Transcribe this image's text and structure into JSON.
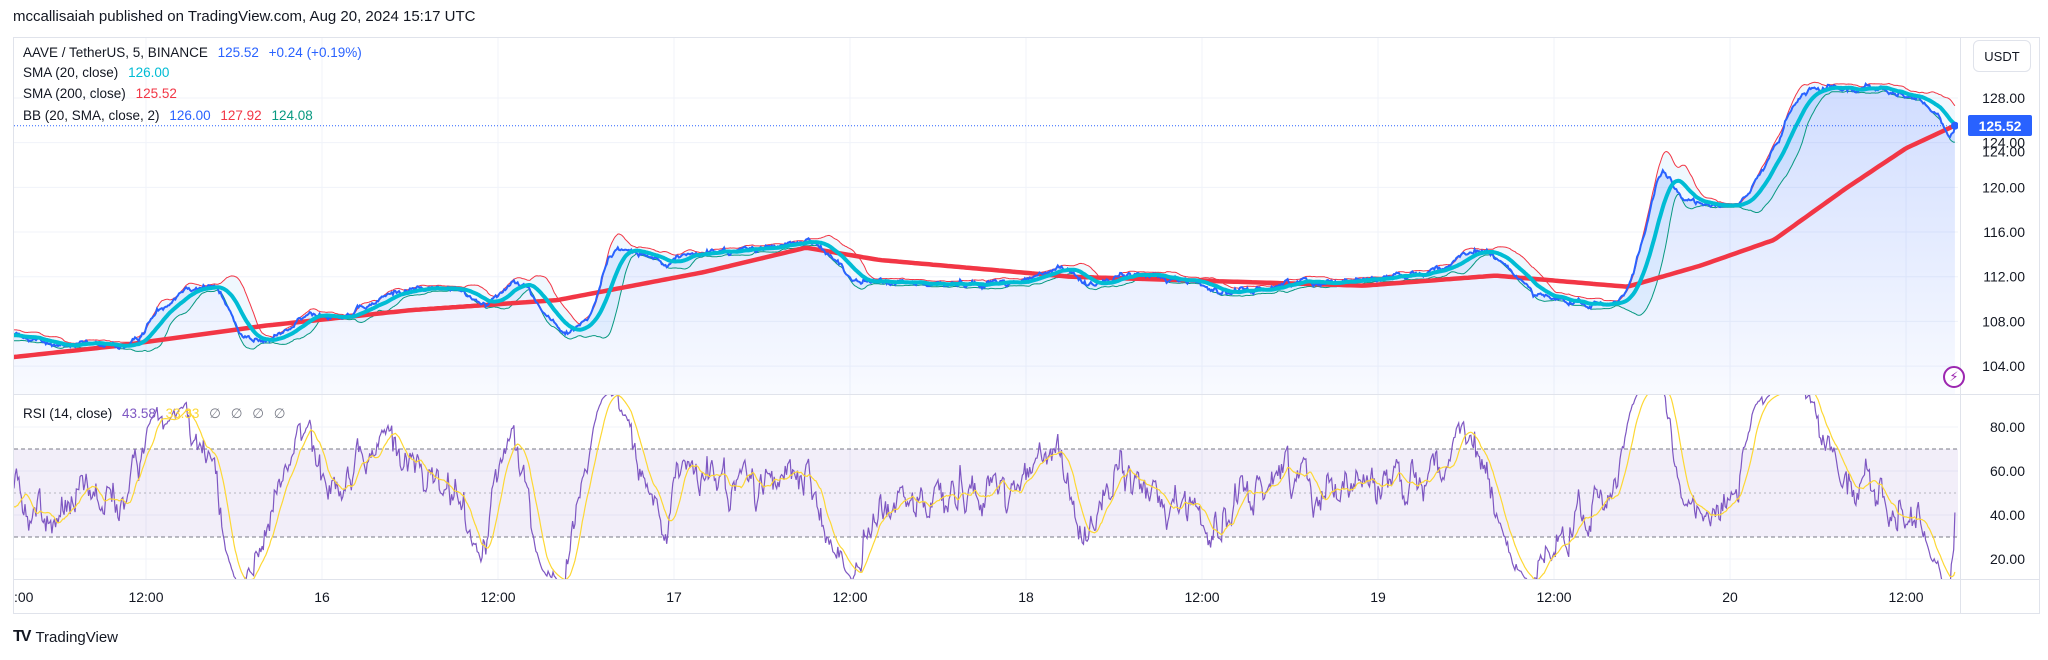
{
  "header": {
    "published": "mccallisaiah published on TradingView.com, Aug 20, 2024 15:17 UTC"
  },
  "legend": {
    "symbol": "AAVE / TetherUS, 5, BINANCE",
    "price": "125.52",
    "change": "+0.24 (+0.19%)",
    "sma20_label": "SMA (20, close)",
    "sma20_value": "126.00",
    "sma200_label": "SMA (200, close)",
    "sma200_value": "125.52",
    "bb_label": "BB (20, SMA, close, 2)",
    "bb_basis": "126.00",
    "bb_upper": "127.92",
    "bb_lower": "124.08",
    "rsi_label": "RSI (14, close)",
    "rsi_value": "43.58",
    "rsi_ma_value": "33.33",
    "rsi_empty": [
      "∅",
      "∅",
      "∅",
      "∅"
    ]
  },
  "price_axis": {
    "currency": "USDT",
    "last_price": "125.52"
  },
  "footer": {
    "brand": "TradingView"
  },
  "colors": {
    "price": "#2962ff",
    "sma20": "#00bcd4",
    "sma200": "#f23645",
    "bb_upper": "#f23645",
    "bb_lower": "#089981",
    "rsi": "#7e57c2",
    "rsi_ma": "#fdd835"
  },
  "chart_data": {
    "type": "line",
    "title": "AAVE / TetherUS, 5, BINANCE",
    "x_unit_hours_from": "Aug 15 00:00",
    "x_ticks": [
      {
        "label": ":00",
        "h": 3
      },
      {
        "label": "12:00",
        "h": 12
      },
      {
        "label": "16",
        "h": 24
      },
      {
        "label": "12:00",
        "h": 36
      },
      {
        "label": "17",
        "h": 48
      },
      {
        "label": "12:00",
        "h": 60
      },
      {
        "label": "18",
        "h": 72
      },
      {
        "label": "12:00",
        "h": 84
      },
      {
        "label": "19",
        "h": 96
      },
      {
        "label": "12:00",
        "h": 108
      },
      {
        "label": "20",
        "h": 120
      },
      {
        "label": "12:00",
        "h": 132
      }
    ],
    "price_ticks": [
      "104.00",
      "108.00",
      "112.00",
      "116.00",
      "120.00",
      "124.00",
      "128.00"
    ],
    "price_ylim": [
      102.5,
      130.5
    ],
    "rsi_ticks": [
      "20.00",
      "40.00",
      "60.00",
      "80.00"
    ],
    "rsi_ylim": [
      15,
      92
    ],
    "rsi_bands": [
      30,
      50,
      70
    ],
    "price_series": [
      [
        0,
        106.8
      ],
      [
        2.9,
        106.8
      ],
      [
        5.6,
        105.8
      ],
      [
        10.9,
        105.8
      ],
      [
        12.3,
        108.7
      ],
      [
        14.5,
        111.3
      ],
      [
        16.7,
        111
      ],
      [
        18.1,
        106.9
      ],
      [
        19.9,
        106
      ],
      [
        23,
        108.7
      ],
      [
        26.1,
        108.7
      ],
      [
        28.8,
        110.8
      ],
      [
        32.3,
        111
      ],
      [
        35,
        109.6
      ],
      [
        37.2,
        112.2
      ],
      [
        38.5,
        109.3
      ],
      [
        40.3,
        106.6
      ],
      [
        42.1,
        108.7
      ],
      [
        43.4,
        114.5
      ],
      [
        45.7,
        114.3
      ],
      [
        47,
        112.8
      ],
      [
        48.3,
        114
      ],
      [
        51.9,
        114.3
      ],
      [
        57.2,
        115.1
      ],
      [
        58.1,
        114.5
      ],
      [
        59.9,
        111.6
      ],
      [
        64.4,
        111.3
      ],
      [
        71.5,
        111.6
      ],
      [
        74.2,
        112.8
      ],
      [
        75.9,
        111.4
      ],
      [
        79.5,
        112.2
      ],
      [
        83.1,
        111.6
      ],
      [
        85.7,
        110.4
      ],
      [
        90.2,
        111.6
      ],
      [
        95.5,
        111.8
      ],
      [
        100,
        112.8
      ],
      [
        103.1,
        114.5
      ],
      [
        104.4,
        112.8
      ],
      [
        107.1,
        110.1
      ],
      [
        110.2,
        109.3
      ],
      [
        112.4,
        109.9
      ],
      [
        113.8,
        115.1
      ],
      [
        115.1,
        122.2
      ],
      [
        116.4,
        118.6
      ],
      [
        117.8,
        118.6
      ],
      [
        120.4,
        118.6
      ],
      [
        122.2,
        121.8
      ],
      [
        124,
        127.2
      ],
      [
        124.9,
        128.6
      ],
      [
        127.6,
        129.2
      ],
      [
        130.2,
        128.8
      ],
      [
        132.9,
        127.4
      ],
      [
        134.2,
        126.2
      ],
      [
        134.9,
        124.1
      ],
      [
        135.3,
        125.52
      ]
    ],
    "sma200_series": [
      [
        2.9,
        104.8
      ],
      [
        10,
        105.8
      ],
      [
        20,
        107.6
      ],
      [
        30,
        109.0
      ],
      [
        40,
        109.9
      ],
      [
        50,
        112.4
      ],
      [
        57,
        114.6
      ],
      [
        62,
        113.5
      ],
      [
        75,
        112
      ],
      [
        95,
        111.2
      ],
      [
        104,
        112.1
      ],
      [
        113,
        111.1
      ],
      [
        118,
        113
      ],
      [
        123,
        115.3
      ],
      [
        128,
        120
      ],
      [
        132,
        123.5
      ],
      [
        135.3,
        125.52
      ]
    ],
    "last": {
      "price": 125.52,
      "sma20": 126.0,
      "sma200": 125.52,
      "bb_upper": 127.92,
      "bb_lower": 124.08,
      "rsi": 43.58,
      "rsi_ma": 33.33
    }
  }
}
